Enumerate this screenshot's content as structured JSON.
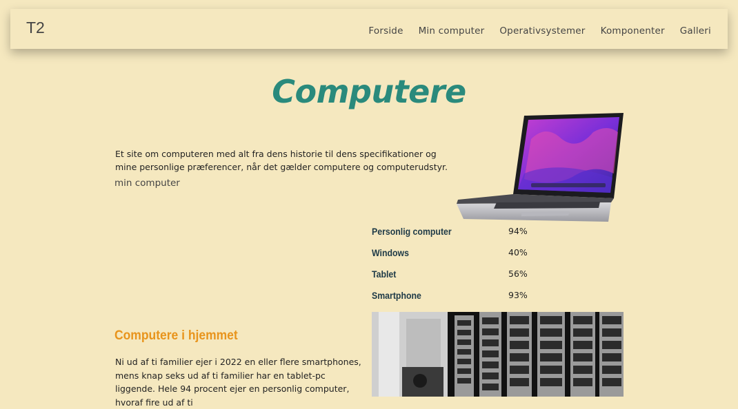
{
  "navbar": {
    "brand": "T2",
    "items": [
      {
        "label": "Forside"
      },
      {
        "label": "Min computer"
      },
      {
        "label": "Operativsystemer"
      },
      {
        "label": "Komponenter"
      },
      {
        "label": "Galleri"
      }
    ]
  },
  "hero": {
    "title": "Computere",
    "intro": "Et site om computeren med alt fra dens historie til dens specifikationer og mine personlige præferencer, når det gælder computere og computerudstyr.",
    "link": "min computer"
  },
  "stats": [
    {
      "label": "Personlig computer",
      "value": "94%"
    },
    {
      "label": "Windows",
      "value": "40%"
    },
    {
      "label": "Tablet",
      "value": "56%"
    },
    {
      "label": "Smartphone",
      "value": "93%"
    }
  ],
  "section": {
    "title": "Computere i hjemmet",
    "body": "Ni ud af ti familier ejer i 2022 en eller flere smartphones, mens knap seks ud af ti familier har en tablet-pc liggende. Hele 94 procent ejer en personlig computer, hvoraf fire ud af ti"
  },
  "colors": {
    "background": "#f5e8bf",
    "title": "#2a8a7c",
    "section_title": "#e8941c",
    "stat_label": "#1e3a47"
  },
  "icons": {
    "laptop": "laptop-image",
    "photo": "server-room-photo"
  }
}
